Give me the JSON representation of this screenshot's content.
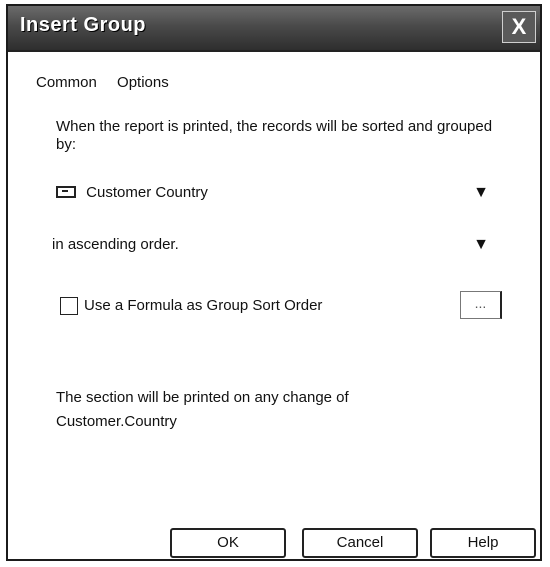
{
  "dialog": {
    "title": "Insert Group",
    "close_label": "X"
  },
  "tabs": [
    {
      "label": "Common"
    },
    {
      "label": "Options"
    }
  ],
  "description": "When the report is printed, the records will be sorted and grouped by:",
  "group_field": {
    "value": "Customer Country",
    "icon": "field-icon",
    "dropdown_icon": "chevron-down-icon"
  },
  "sort_order": {
    "value": "in ascending order.",
    "dropdown_icon": "chevron-down-icon"
  },
  "formula_option": {
    "label": "Use a Formula as Group Sort Order",
    "checked": false,
    "button_label": "..."
  },
  "section_note": {
    "line1": "The section will be printed on any change of",
    "line2": "Customer.Country"
  },
  "buttons": {
    "ok": "OK",
    "cancel": "Cancel",
    "help": "Help"
  }
}
